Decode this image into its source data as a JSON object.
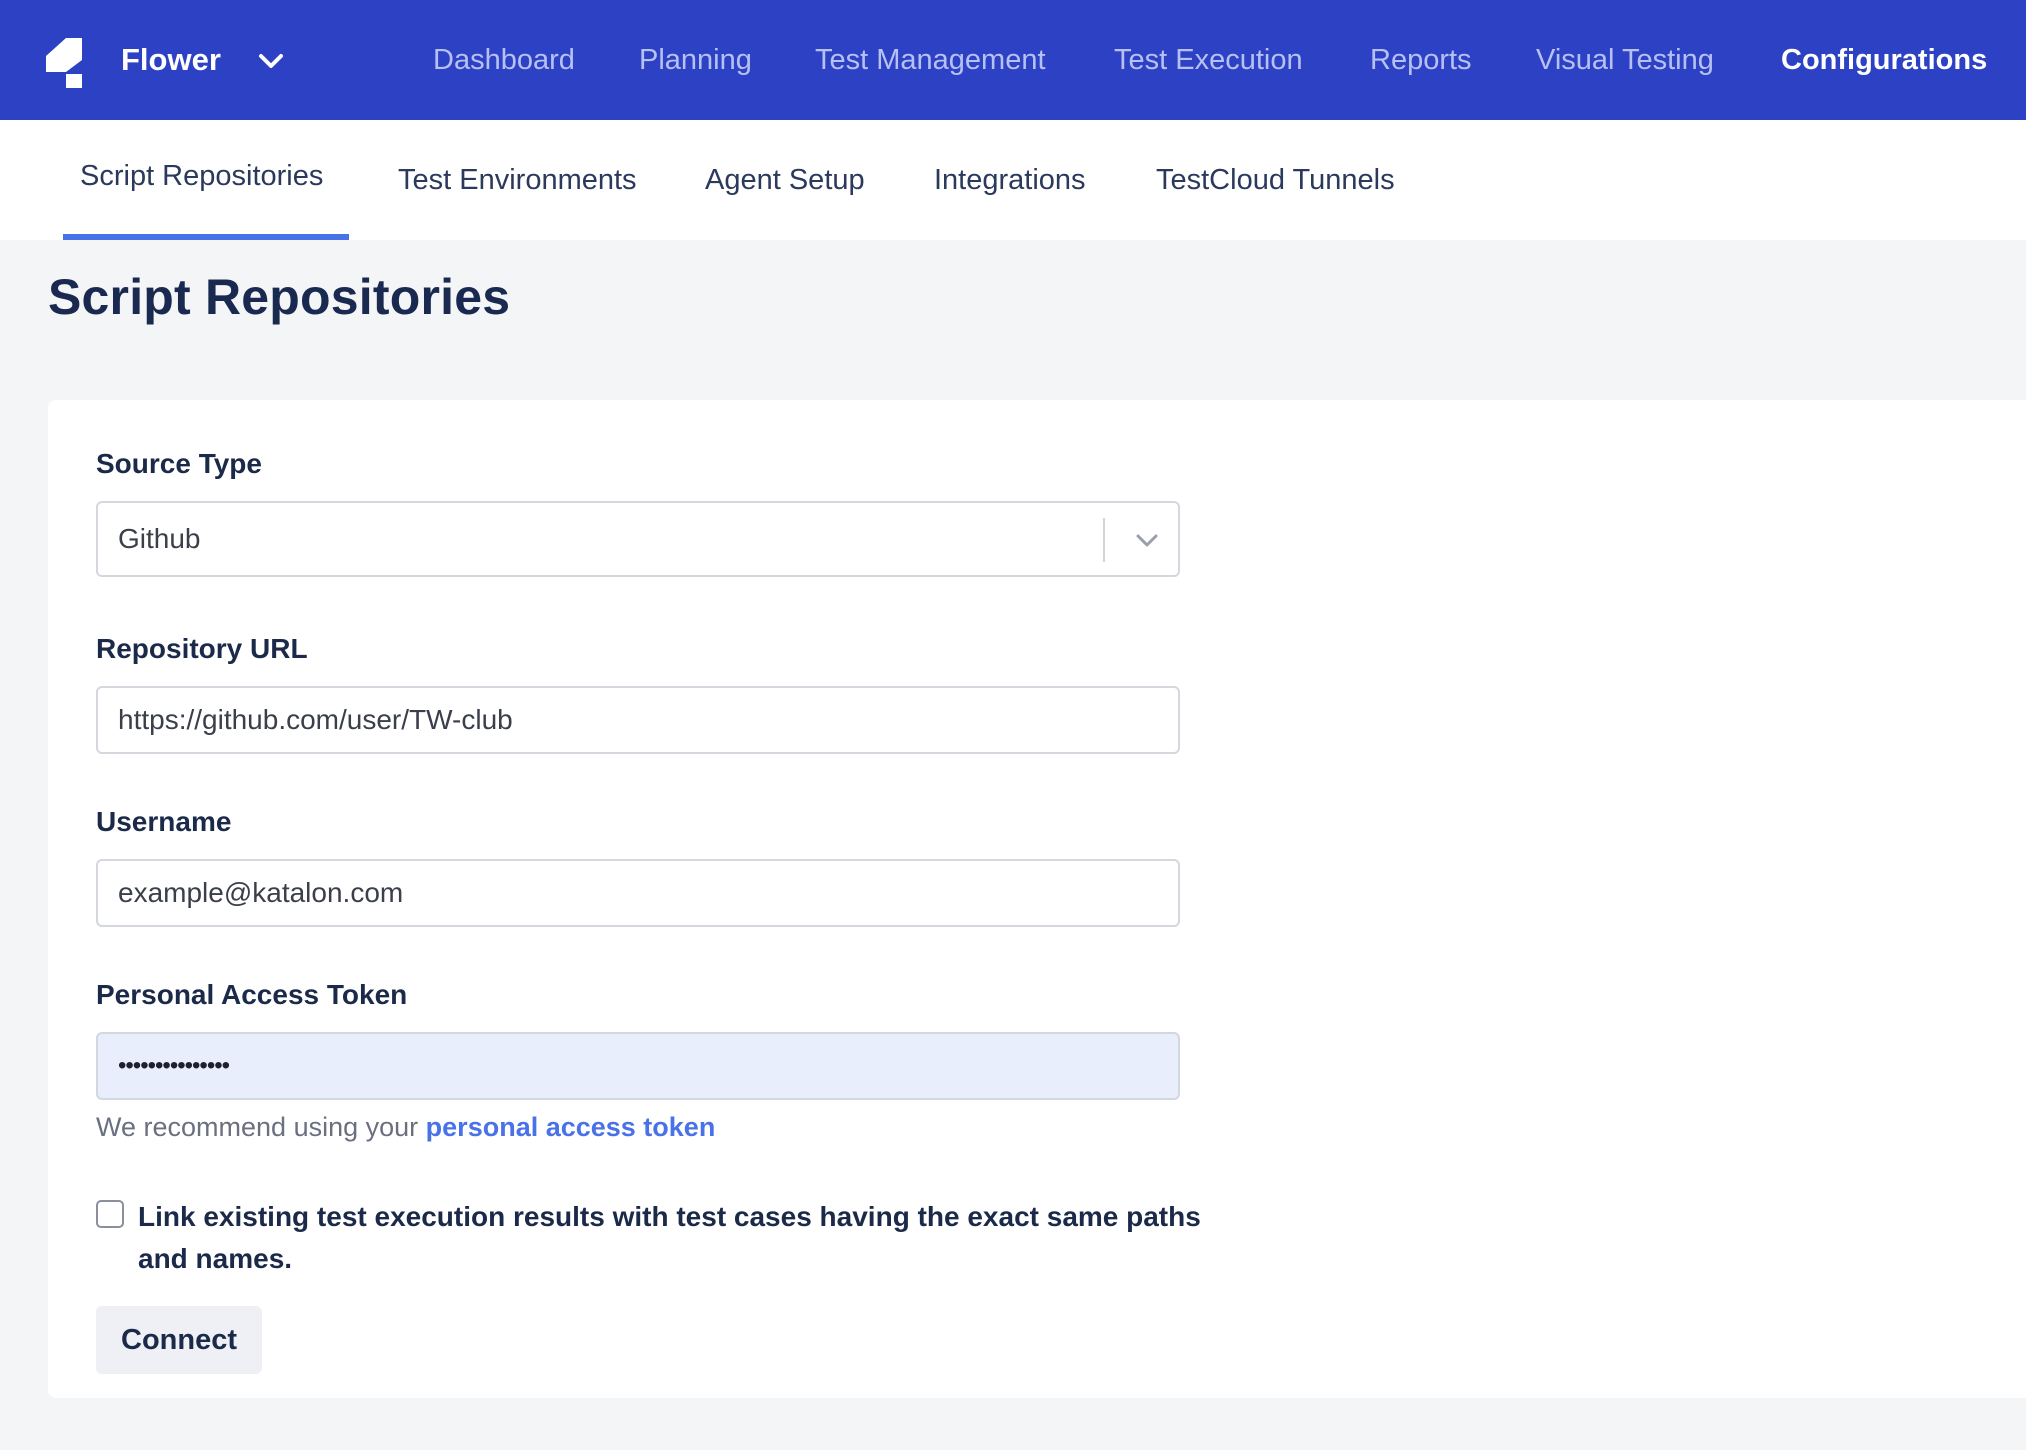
{
  "app": {
    "project_name": "Flower"
  },
  "main_nav": {
    "items": [
      {
        "label": "Dashboard",
        "active": false
      },
      {
        "label": "Planning",
        "active": false
      },
      {
        "label": "Test Management",
        "active": false
      },
      {
        "label": "Test Execution",
        "active": false
      },
      {
        "label": "Reports",
        "active": false
      },
      {
        "label": "Visual Testing",
        "active": false
      },
      {
        "label": "Configurations",
        "active": true
      }
    ]
  },
  "sub_tabs": {
    "items": [
      {
        "label": "Script Repositories",
        "active": true
      },
      {
        "label": "Test Environments",
        "active": false
      },
      {
        "label": "Agent Setup",
        "active": false
      },
      {
        "label": "Integrations",
        "active": false
      },
      {
        "label": "TestCloud Tunnels",
        "active": false
      }
    ]
  },
  "page": {
    "title": "Script Repositories"
  },
  "form": {
    "source_type": {
      "label": "Source Type",
      "value": "Github"
    },
    "repository_url": {
      "label": "Repository URL",
      "value": "https://github.com/user/TW-club"
    },
    "username": {
      "label": "Username",
      "value": "example@katalon.com"
    },
    "token": {
      "label": "Personal Access Token",
      "value": "•••••••••••••••"
    },
    "helper_text": "We recommend using your",
    "helper_link": "personal access token",
    "link_checkbox": {
      "label": "Link existing test execution results with test cases having the exact same paths and names.",
      "checked": false
    },
    "connect_label": "Connect"
  },
  "colors": {
    "topbar": "#2c41c4",
    "accent": "#4a72e8",
    "autofill": "#e8eefc"
  },
  "icons": {
    "logo": "katalon-logo-icon",
    "project_chevron": "chevron-down-icon",
    "select_chevron": "chevron-down-icon"
  }
}
